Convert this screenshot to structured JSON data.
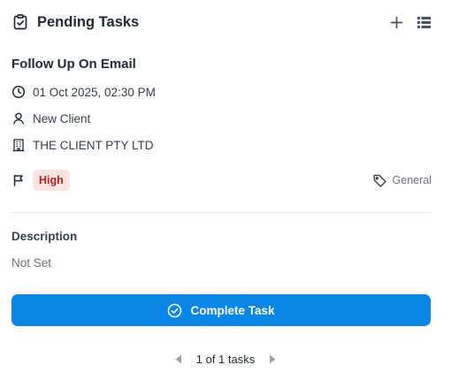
{
  "header": {
    "title": "Pending Tasks",
    "icons": {
      "title": "clipboard-check-icon",
      "add": "plus-icon",
      "list": "list-view-icon"
    }
  },
  "task": {
    "title": "Follow Up On Email",
    "datetime": "01 Oct 2025, 02:30 PM",
    "contact": "New Client",
    "company": "THE CLIENT PTY LTD",
    "priority": "High",
    "category": "General"
  },
  "description": {
    "label": "Description",
    "value": "Not Set"
  },
  "actions": {
    "complete_label": "Complete Task"
  },
  "pagination": {
    "text": "1 of 1 tasks"
  },
  "colors": {
    "accent": "#0a87e6",
    "priority_bg": "#fde3e1",
    "priority_text": "#b42318"
  }
}
